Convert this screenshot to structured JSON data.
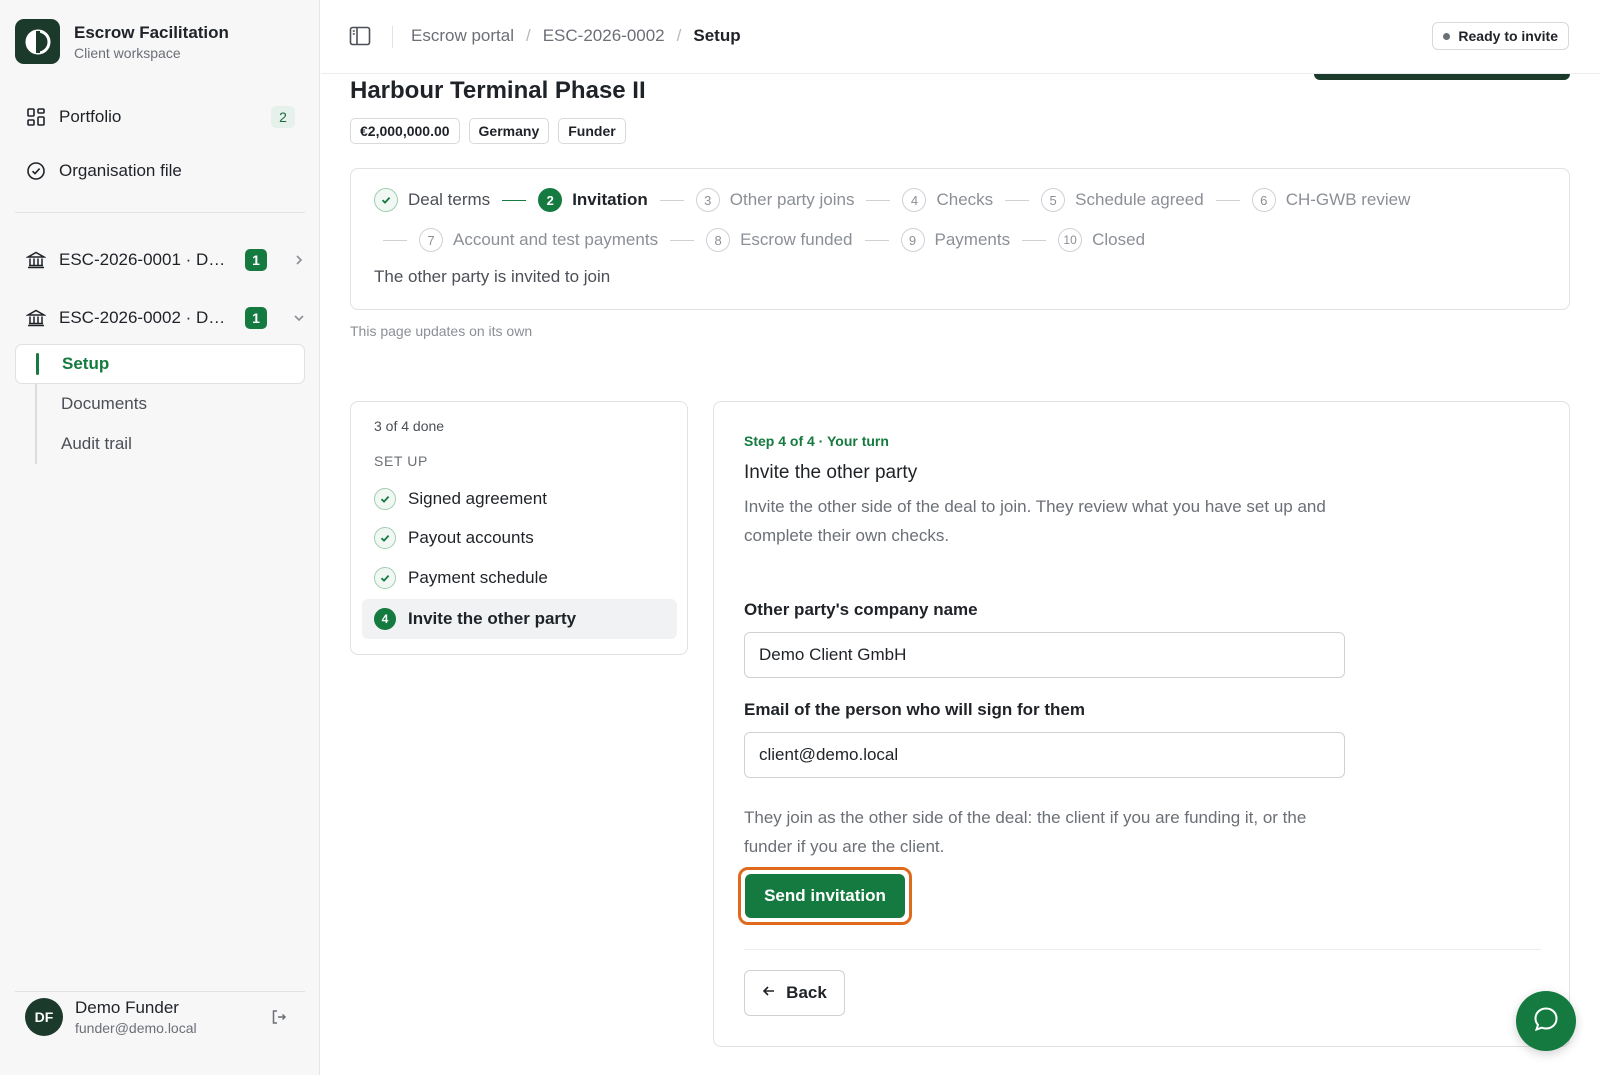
{
  "brand": {
    "title": "Escrow Facilitation",
    "subtitle": "Client workspace"
  },
  "sidebar": {
    "items": [
      {
        "label": "Portfolio",
        "icon": "grid-icon",
        "count": "2"
      },
      {
        "label": "Organisation file",
        "icon": "check-circle-icon"
      }
    ],
    "deals": [
      {
        "label": "ESC-2026-0001 · D…",
        "icon": "bank-icon",
        "badge": "1",
        "chevron": "chevron-right-icon"
      },
      {
        "label": "ESC-2026-0002 · D…",
        "icon": "bank-icon",
        "badge": "1",
        "chevron": "chevron-down-icon"
      }
    ],
    "subnav": [
      {
        "label": "Setup",
        "active": true
      },
      {
        "label": "Documents"
      },
      {
        "label": "Audit trail"
      }
    ]
  },
  "user": {
    "initials": "DF",
    "name": "Demo Funder",
    "email": "funder@demo.local"
  },
  "topbar": {
    "breadcrumbs": [
      "Escrow portal",
      "ESC-2026-0002",
      "Setup"
    ],
    "status": "Ready to invite"
  },
  "deal": {
    "title": "Harbour Terminal Phase II",
    "tags": [
      "€2,000,000.00",
      "Germany",
      "Funder"
    ]
  },
  "stepper": {
    "steps": [
      {
        "num": "1",
        "label": "Deal terms",
        "state": "done"
      },
      {
        "num": "2",
        "label": "Invitation",
        "state": "current"
      },
      {
        "num": "3",
        "label": "Other party joins",
        "state": "todo"
      },
      {
        "num": "4",
        "label": "Checks",
        "state": "todo"
      },
      {
        "num": "5",
        "label": "Schedule agreed",
        "state": "todo"
      },
      {
        "num": "6",
        "label": "CH-GWB review",
        "state": "todo"
      },
      {
        "num": "7",
        "label": "Account and test payments",
        "state": "todo"
      },
      {
        "num": "8",
        "label": "Escrow funded",
        "state": "todo"
      },
      {
        "num": "9",
        "label": "Payments",
        "state": "todo"
      },
      {
        "num": "10",
        "label": "Closed",
        "state": "todo"
      }
    ],
    "description": "The other party is invited to join",
    "auto_note": "This page updates on its own"
  },
  "checklist": {
    "progress": "3 of 4 done",
    "section": "SET UP",
    "items": [
      {
        "label": "Signed agreement",
        "state": "done"
      },
      {
        "label": "Payout accounts",
        "state": "done"
      },
      {
        "label": "Payment schedule",
        "state": "done"
      },
      {
        "num": "4",
        "label": "Invite the other party",
        "state": "current"
      }
    ]
  },
  "form": {
    "eyebrow": "Step 4 of 4 · Your turn",
    "title": "Invite the other party",
    "description": "Invite the other side of the deal to join. They review what you have set up and complete their own checks.",
    "company_label": "Other party's company name",
    "company_value": "Demo Client GmbH",
    "email_label": "Email of the person who will sign for them",
    "email_value": "client@demo.local",
    "note": "They join as the other side of the deal: the client if you are funding it, or the funder if you are the client.",
    "send_label": "Send invitation",
    "back_label": "Back"
  },
  "colors": {
    "accent": "#157a3f",
    "brand_dark": "#1b3a2b",
    "highlight": "#e06a1b"
  }
}
